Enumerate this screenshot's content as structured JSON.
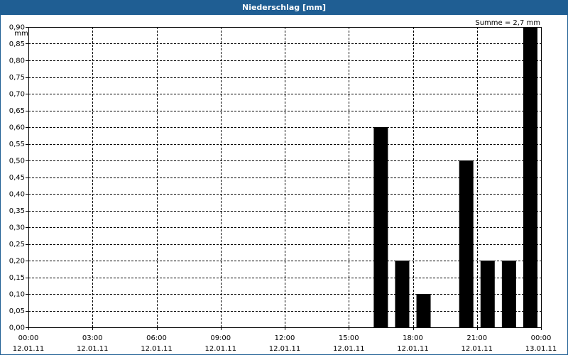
{
  "window": {
    "title": "Niederschlag [mm]"
  },
  "chart_data": {
    "type": "bar",
    "title": "Niederschlag [mm]",
    "ylabel": "mm",
    "annotation": "Summe = 2,7 mm",
    "ylim": [
      0,
      0.9
    ],
    "y_ticks": [
      "0,00",
      "0,05",
      "0,10",
      "0,15",
      "0,20",
      "0,25",
      "0,30",
      "0,35",
      "0,40",
      "0,45",
      "0,50",
      "0,55",
      "0,60",
      "0,65",
      "0,70",
      "0,75",
      "0,80",
      "0,85",
      "0,90"
    ],
    "x_ticks": [
      {
        "time": "00:00",
        "date": "12.01.11"
      },
      {
        "time": "03:00",
        "date": "12.01.11"
      },
      {
        "time": "06:00",
        "date": "12.01.11"
      },
      {
        "time": "09:00",
        "date": "12.01.11"
      },
      {
        "time": "12:00",
        "date": "12.01.11"
      },
      {
        "time": "15:00",
        "date": "12.01.11"
      },
      {
        "time": "18:00",
        "date": "12.01.11"
      },
      {
        "time": "21:00",
        "date": "12.01.11"
      },
      {
        "time": "00:00",
        "date": "13.01.11"
      }
    ],
    "grid": true,
    "bar_color": "#000000",
    "bars": [
      {
        "time": "16:30",
        "value": 0.6
      },
      {
        "time": "17:30",
        "value": 0.2
      },
      {
        "time": "18:30",
        "value": 0.1
      },
      {
        "time": "20:30",
        "value": 0.5
      },
      {
        "time": "21:30",
        "value": 0.2
      },
      {
        "time": "22:30",
        "value": 0.2
      },
      {
        "time": "23:30",
        "value": 0.9
      }
    ]
  }
}
